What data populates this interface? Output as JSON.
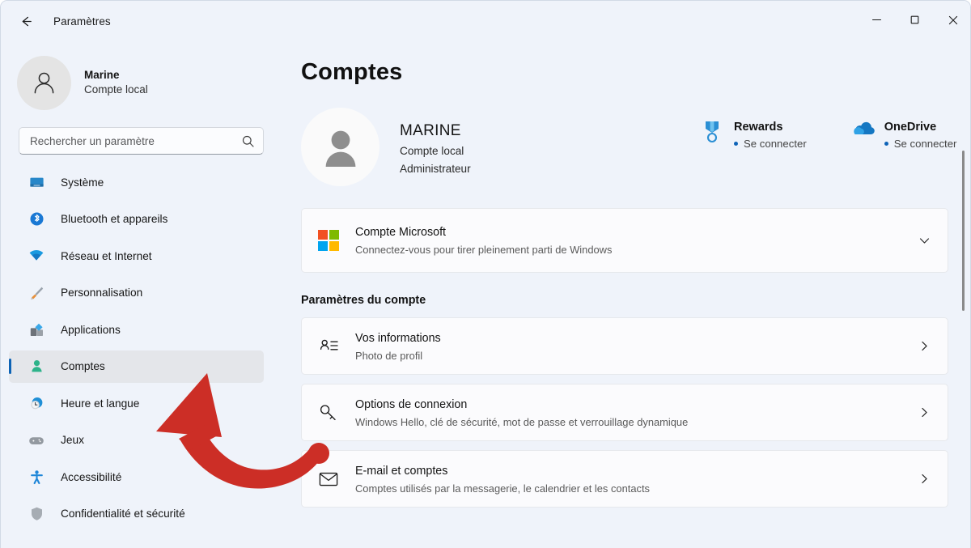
{
  "window": {
    "app_title": "Paramètres",
    "back_icon": "back-arrow-icon",
    "controls": {
      "minimize": "minimize-icon",
      "maximize": "maximize-icon",
      "close": "close-icon"
    }
  },
  "sidebar": {
    "profile": {
      "name": "Marine",
      "subtitle": "Compte local",
      "avatar_icon": "person-avatar-icon"
    },
    "search": {
      "placeholder": "Rechercher un paramètre",
      "value": "",
      "icon": "search-icon"
    },
    "items": [
      {
        "label": "Système",
        "icon": "monitor-icon",
        "selected": false
      },
      {
        "label": "Bluetooth et appareils",
        "icon": "bluetooth-icon",
        "selected": false
      },
      {
        "label": "Réseau et Internet",
        "icon": "wifi-icon",
        "selected": false
      },
      {
        "label": "Personnalisation",
        "icon": "paintbrush-icon",
        "selected": false
      },
      {
        "label": "Applications",
        "icon": "apps-icon",
        "selected": false
      },
      {
        "label": "Comptes",
        "icon": "person-icon",
        "selected": true
      },
      {
        "label": "Heure et langue",
        "icon": "clock-globe-icon",
        "selected": false
      },
      {
        "label": "Jeux",
        "icon": "gamepad-icon",
        "selected": false
      },
      {
        "label": "Accessibilité",
        "icon": "accessibility-icon",
        "selected": false
      },
      {
        "label": "Confidentialité et sécurité",
        "icon": "shield-icon",
        "selected": false
      }
    ]
  },
  "main": {
    "page_title": "Comptes",
    "hero": {
      "avatar_icon": "person-avatar-large-icon",
      "name": "MARINE",
      "line1": "Compte local",
      "line2": "Administrateur",
      "links": [
        {
          "title": "Rewards",
          "action": "Se connecter",
          "icon": "rewards-medal-icon"
        },
        {
          "title": "OneDrive",
          "action": "Se connecter",
          "icon": "onedrive-cloud-icon"
        }
      ]
    },
    "microsoft_card": {
      "title": "Compte Microsoft",
      "subtitle": "Connectez-vous pour tirer pleinement parti de Windows",
      "icon": "microsoft-logo-icon",
      "chevron": "chevron-down-icon"
    },
    "section_heading": "Paramètres du compte",
    "settings": [
      {
        "title": "Vos informations",
        "subtitle": "Photo de profil",
        "icon": "user-info-icon",
        "chevron": "chevron-right-icon"
      },
      {
        "title": "Options de connexion",
        "subtitle": "Windows Hello, clé de sécurité, mot de passe et verrouillage dynamique",
        "icon": "key-icon",
        "chevron": "chevron-right-icon"
      },
      {
        "title": "E-mail et comptes",
        "subtitle": "Comptes utilisés par la messagerie, le calendrier et les contacts",
        "icon": "envelope-icon",
        "chevron": "chevron-right-icon"
      }
    ]
  },
  "annotation": {
    "arrow_icon": "red-curved-arrow-annotation",
    "color": "#cc2e26"
  },
  "colors": {
    "window_background": "#eff3fa",
    "card_background": "#fbfbfd",
    "accent": "#0d63b5",
    "selected_item": "#e4e6ea",
    "annotation_red": "#cc2e26"
  }
}
